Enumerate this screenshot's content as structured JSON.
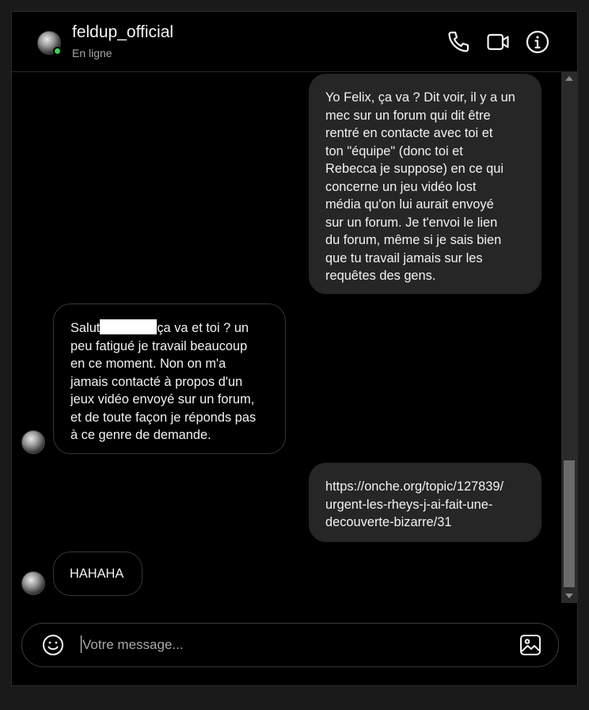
{
  "header": {
    "contact_name": "feldup_official",
    "status": "En ligne",
    "icons": [
      "phone-icon",
      "video-camera-icon",
      "info-icon"
    ]
  },
  "messages": [
    {
      "direction": "outgoing",
      "text": "Yo Felix, ça va ? Dit voir, il y a un\nmec sur un forum qui dit être\nrentré en contacte avec toi et\nton \"équipe\" (donc toi et\nRebecca je suppose) en ce qui\nconcerne un jeu vidéo lost\nmédia qu'on lui aurait envoyé\nsur un forum. Je t'envoi le lien\ndu forum, même si je sais bien\nque tu travail jamais sur les\nrequêtes des gens."
    },
    {
      "direction": "incoming",
      "text_before_redaction": "Salut",
      "text_after_redaction": "ça va et toi ? un\npeu fatigué je travail beaucoup\nen ce moment. Non on m'a\njamais contacté à propos d'un\njeux vidéo envoyé sur un forum,\net de toute façon je réponds pas\nà ce genre de demande."
    },
    {
      "direction": "outgoing",
      "text": "https://onche.org/topic/127839/\nurgent-les-rheys-j-ai-fait-une-\ndecouverte-bizarre/31"
    },
    {
      "direction": "incoming",
      "text": "HAHAHA"
    }
  ],
  "composer": {
    "placeholder": "Votre message...",
    "value": "",
    "icons": [
      "emoji-icon",
      "image-icon"
    ]
  },
  "colors": {
    "background": "#000000",
    "outgoing_bubble": "#262626",
    "incoming_border": "#363636",
    "online": "#3ecf4a"
  }
}
